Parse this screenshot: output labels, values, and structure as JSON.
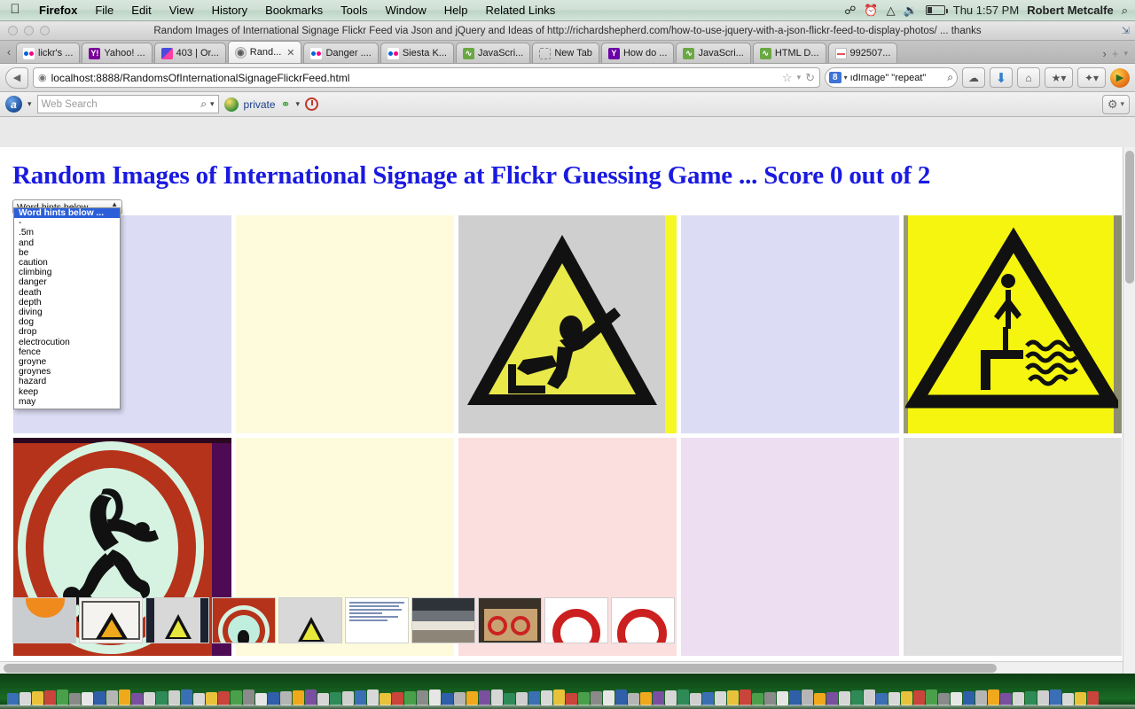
{
  "menubar": {
    "apple": "",
    "items": [
      "Firefox",
      "File",
      "Edit",
      "View",
      "History",
      "Bookmarks",
      "Tools",
      "Window",
      "Help",
      "Related Links"
    ],
    "bluetooth_icon": "bluetooth-icon",
    "timemachine_icon": "time-machine-icon",
    "wifi_icon": "wifi-icon",
    "volume_icon": "volume-icon",
    "battery_icon": "battery-icon",
    "clock": "Thu 1:57 PM",
    "user": "Robert Metcalfe",
    "spotlight": "⌕"
  },
  "window": {
    "title": "Random Images of International Signage Flickr Feed via Json and jQuery and Ideas of http://richardshepherd.com/how-to-use-jquery-with-a-json-flickr-feed-to-display-photos/ ... thanks"
  },
  "tabs": [
    {
      "label": "lickr's ...",
      "favicon": "flickr-icon",
      "active": false,
      "closable": false
    },
    {
      "label": "Yahoo! ...",
      "favicon": "yahoo-icon",
      "active": false,
      "closable": false
    },
    {
      "label": "403 | Or...",
      "favicon": "org-icon",
      "active": false,
      "closable": false
    },
    {
      "label": "Rand...",
      "favicon": "globe-icon",
      "active": true,
      "closable": true
    },
    {
      "label": "Danger ....",
      "favicon": "flickr-icon",
      "active": false,
      "closable": false
    },
    {
      "label": "Siesta K...",
      "favicon": "flickr-icon",
      "active": false,
      "closable": false
    },
    {
      "label": "JavaScri...",
      "favicon": "js-icon",
      "active": false,
      "closable": false
    },
    {
      "label": "New Tab",
      "favicon": "newtab-icon",
      "active": false,
      "closable": false
    },
    {
      "label": "How do ...",
      "favicon": "yahoo-answers-icon",
      "active": false,
      "closable": false
    },
    {
      "label": "JavaScri...",
      "favicon": "js-icon",
      "active": false,
      "closable": false
    },
    {
      "label": "HTML D...",
      "favicon": "js-icon",
      "active": false,
      "closable": false
    },
    {
      "label": "992507...",
      "favicon": "html-icon",
      "active": false,
      "closable": false
    }
  ],
  "tabbar": {
    "scroll_left": "‹",
    "list_all": "›",
    "new_tab": "+",
    "menu": "▾"
  },
  "navbar": {
    "back": "◀",
    "url": "localhost:8888/RandomsOfInternationalSignageFlickrFeed.html",
    "site_icon": "globe-icon",
    "bookmark_star": "☆",
    "star_menu": "▾",
    "reload": "↻",
    "search_engine": "8",
    "search_engine_arrow": "▾",
    "search_value": "ıdImage\" \"repeat\"",
    "search_icon": "⌕",
    "buttons": [
      "sync-icon",
      "downloads-icon",
      "home-icon",
      "bookmarks-icon",
      "extension-icon"
    ],
    "firefox_badge": "firefox-badge-icon"
  },
  "toolbar2": {
    "alexa_icon": "a",
    "alexa_arrow": "▾",
    "web_search_placeholder": "Web Search",
    "web_search_value": "",
    "search_icon": "⌕",
    "search_arrow": "▾",
    "globe_icon": "globe-icon",
    "private_label": "private",
    "chain_icon": "⚭",
    "chain_arrow": "▾",
    "history_icon": "history-clock-icon",
    "gear_icon": "⚙",
    "gear_arrow": "▾"
  },
  "page": {
    "heading": "Random Images of International Signage at Flickr Guessing Game ... Score 0 out of 2",
    "select": {
      "label": "Word hints below ...",
      "selected": "Word hints below ...",
      "options": [
        "Word hints below ...",
        "-",
        ".5m",
        "and",
        "be",
        "caution",
        "climbing",
        "danger",
        "death",
        "depth",
        "diving",
        "dog",
        "drop",
        "electrocution",
        "fence",
        "groyne",
        "groynes",
        "hazard",
        "keep",
        "may"
      ]
    },
    "grid": [
      {
        "name": "cell-empty-lavender",
        "kind": "blank",
        "color": "#dcdcf5"
      },
      {
        "name": "cell-empty-ivory",
        "kind": "blank",
        "color": "#fdfbdc"
      },
      {
        "name": "cell-sign-slip-hazard",
        "kind": "sign",
        "art": "slip-hazard-triangle",
        "color": "#cfcfcf"
      },
      {
        "name": "cell-empty-lavender",
        "kind": "blank",
        "color": "#dcdcf5"
      },
      {
        "name": "cell-sign-deep-water-diving",
        "kind": "sign",
        "art": "diving-triangle",
        "color": "#f5f50f"
      },
      {
        "name": "cell-sign-no-skating",
        "kind": "sign",
        "art": "no-skating-circle",
        "color": "#b5331a"
      },
      {
        "name": "cell-empty-ivory",
        "kind": "blank",
        "color": "#fdfbdc"
      },
      {
        "name": "cell-empty-pink",
        "kind": "blank",
        "color": "#fbdede"
      },
      {
        "name": "cell-empty-orchid",
        "kind": "blank",
        "color": "#eddef2"
      },
      {
        "name": "cell-empty-gray",
        "kind": "blank",
        "color": "#e0e0e0"
      }
    ],
    "thumbnails": [
      {
        "name": "thumb-orange-sun",
        "color": "#c9cdd0"
      },
      {
        "name": "thumb-warning-triangle-orange",
        "color": "#f2f2f0"
      },
      {
        "name": "thumb-warning-triangle-yellow",
        "color": "#1a1f2b"
      },
      {
        "name": "thumb-no-skating-circle",
        "color": "#b5331a"
      },
      {
        "name": "thumb-warning-triangle-small",
        "color": "#d5d5d5"
      },
      {
        "name": "thumb-text-notice",
        "color": "#ffffff"
      },
      {
        "name": "thumb-beach-groyne",
        "color": "#5c6268"
      },
      {
        "name": "thumb-two-prohibition-signs",
        "color": "#8a6a45"
      },
      {
        "name": "thumb-prohibition-sign-large",
        "color": "#ffffff"
      },
      {
        "name": "thumb-prohibition-sign-large-2",
        "color": "#ffffff"
      }
    ]
  },
  "scrollbars": {
    "vertical": "vertical-scrollbar",
    "horizontal": "horizontal-scrollbar"
  },
  "dock": {
    "name": "macos-dock"
  }
}
